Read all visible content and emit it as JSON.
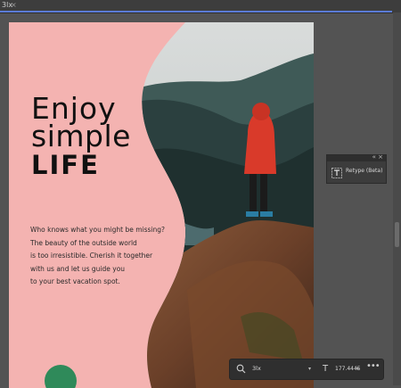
{
  "tab": {
    "title": "3lx",
    "close": "×"
  },
  "headline": {
    "line1": "Enjoy",
    "line2": "simple",
    "line3": "LIFE"
  },
  "paragraph": [
    "Who knows what you might be missing?",
    "The beauty of the outside world",
    "is too irresistible. Cherish it together",
    "with us and let us guide you",
    "to your best vacation spot."
  ],
  "panel": {
    "label": "Retype (Beta)",
    "controls": "« ×"
  },
  "context_bar": {
    "font_value": "3lx",
    "size_value": "177.4445",
    "more": "•••"
  },
  "colors": {
    "artboard_bg": "#f4b3b1",
    "accent_dot": "#2f8a5a",
    "highlight": "#5b7bd5"
  }
}
